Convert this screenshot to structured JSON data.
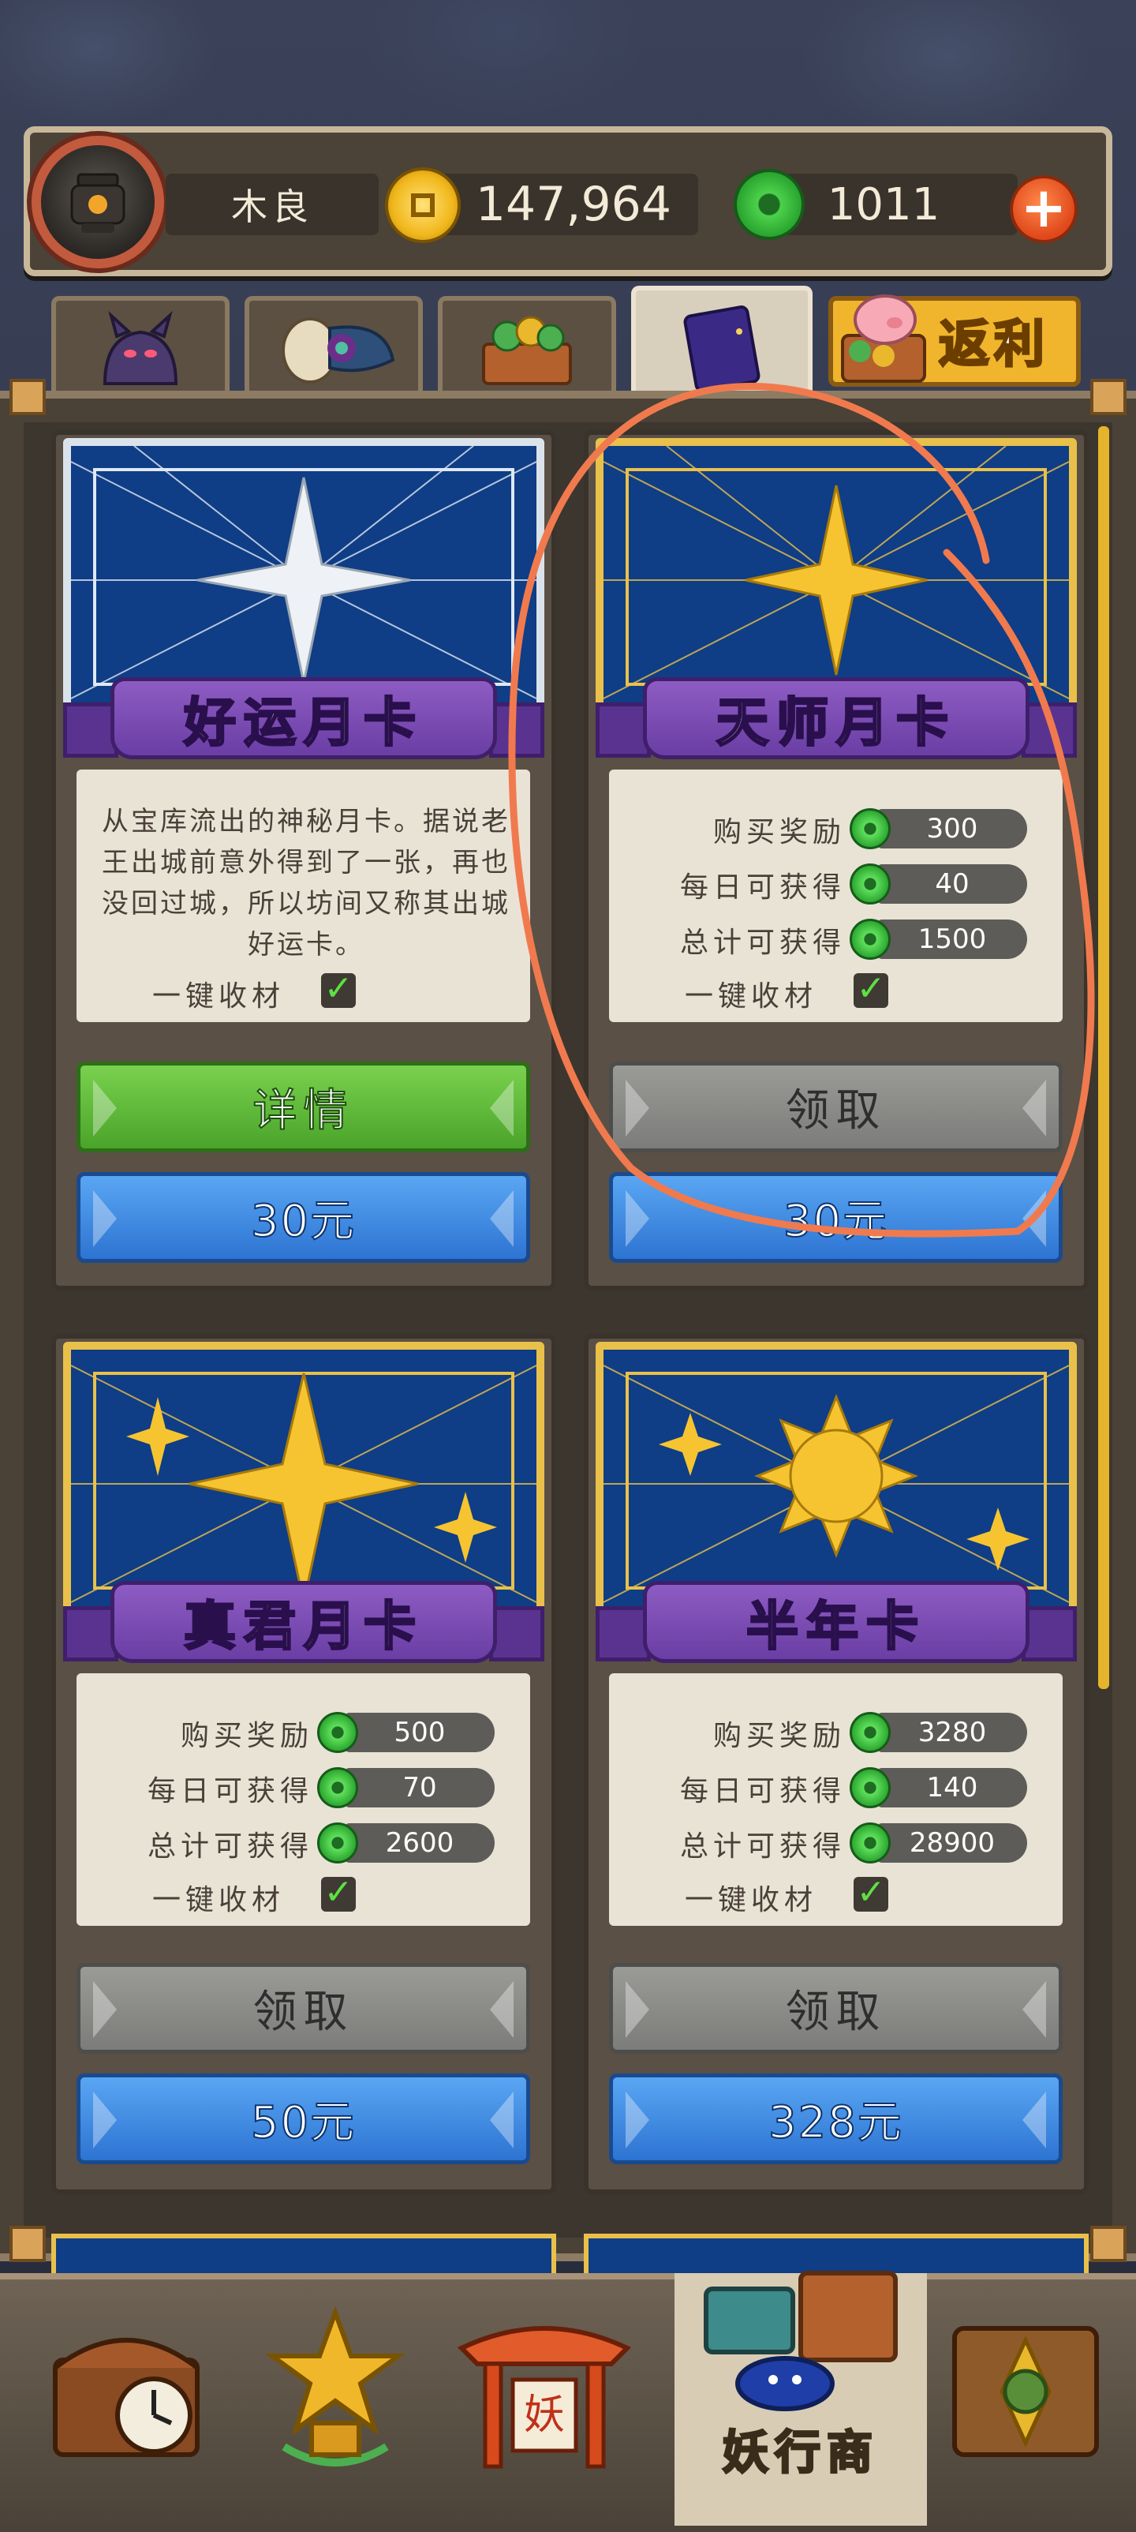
{
  "header": {
    "player_name": "木良",
    "coins": "147,964",
    "jade": "1011",
    "plus_label": "+"
  },
  "tabs": {
    "rebate_label": "返利"
  },
  "cards": [
    {
      "title": "好运月卡",
      "description": "从宝库流出的神秘月卡。据说老王出城前意外得到了一张，再也没回过城，所以坊间又称其出城好运卡。",
      "onekey_label": "一键收材",
      "onekey_checked": "✓",
      "primary_button": "详情",
      "price_button": "30元"
    },
    {
      "title": "天师月卡",
      "rows": [
        {
          "label": "购买奖励",
          "value": "300"
        },
        {
          "label": "每日可获得",
          "value": "40"
        },
        {
          "label": "总计可获得",
          "value": "1500"
        }
      ],
      "onekey_label": "一键收材",
      "onekey_checked": "✓",
      "primary_button": "领取",
      "price_button": "30元"
    },
    {
      "title": "真君月卡",
      "rows": [
        {
          "label": "购买奖励",
          "value": "500"
        },
        {
          "label": "每日可获得",
          "value": "70"
        },
        {
          "label": "总计可获得",
          "value": "2600"
        }
      ],
      "onekey_label": "一键收材",
      "onekey_checked": "✓",
      "primary_button": "领取",
      "price_button": "50元"
    },
    {
      "title": "半年卡",
      "rows": [
        {
          "label": "购买奖励",
          "value": "3280"
        },
        {
          "label": "每日可获得",
          "value": "140"
        },
        {
          "label": "总计可获得",
          "value": "28900"
        }
      ],
      "onekey_label": "一键收材",
      "onekey_checked": "✓",
      "primary_button": "领取",
      "price_button": "328元"
    }
  ],
  "bottom_nav": {
    "active_label": "妖行商",
    "shrine_char": "妖"
  },
  "colors": {
    "annotation": "#f07a4e",
    "gold": "#e9c14a",
    "ribbon": "#7a4bb5",
    "green_button": "#5fb83a",
    "blue_button": "#3d8be0",
    "gray_button": "#8a8a88"
  }
}
